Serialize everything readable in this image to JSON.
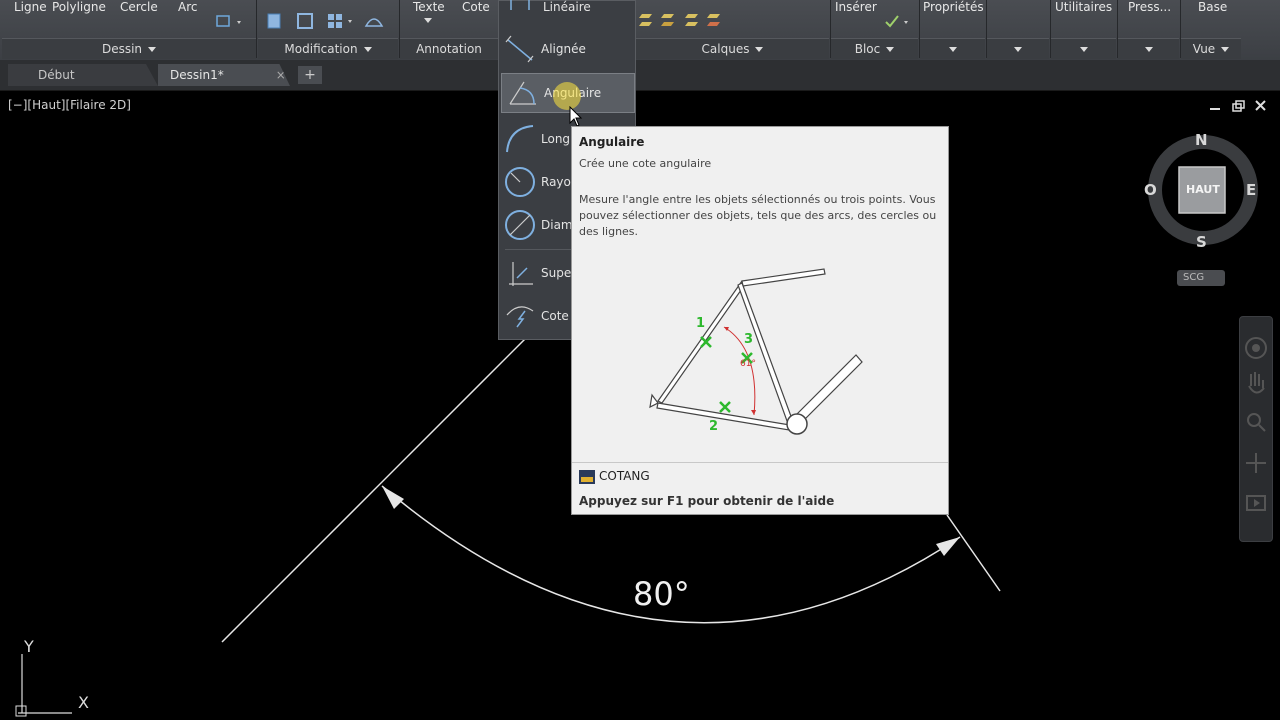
{
  "ribbon": {
    "draw_tools": [
      "Ligne",
      "Polyligne",
      "Cercle",
      "Arc"
    ],
    "annotation_tools": [
      "Texte",
      "Cote"
    ],
    "panels": {
      "dessin": "Dessin",
      "modification": "Modification",
      "annotation": "Annotation",
      "calques": "Calques",
      "bloc": "Bloc",
      "vue": "Vue"
    },
    "right_tools": {
      "inserer": "Insérer",
      "proprietes": "Propriétés",
      "utilitaires": "Utilitaires",
      "presse_papiers": "Press...",
      "base": "Base"
    }
  },
  "tabs": {
    "start": "Début",
    "drawing": "Dessin1*",
    "close": "×",
    "add": "+"
  },
  "viewport": {
    "label": "[−][Haut][Filaire 2D]",
    "dimension_text": "80°",
    "ucs_y": "Y",
    "ucs_x": "X"
  },
  "dropdown": {
    "items": [
      {
        "label": "Linéaire",
        "highlighted": false
      },
      {
        "label": "Alignée",
        "highlighted": false
      },
      {
        "label": "Angulaire",
        "highlighted": true
      },
      {
        "label": "Longu",
        "highlighted": false
      },
      {
        "label": "Rayon",
        "highlighted": false
      },
      {
        "label": "Diam",
        "highlighted": false
      },
      {
        "label": "Super",
        "highlighted": false
      },
      {
        "label": "Cote",
        "highlighted": false
      }
    ]
  },
  "tooltip": {
    "title": "Angulaire",
    "subtitle": "Crée une cote angulaire",
    "description": "Mesure l'angle entre les objets sélectionnés ou trois points. Vous pouvez sélectionner des objets, tels que des arcs, des cercles ou des lignes.",
    "illustration": {
      "point1": "1",
      "point2": "2",
      "point3": "3",
      "angle": "61°"
    },
    "command": "COTANG",
    "help": "Appuyez sur F1 pour obtenir de l'aide"
  },
  "viewcube": {
    "north": "N",
    "south": "S",
    "east": "E",
    "west": "O",
    "face": "HAUT",
    "ucs": "SCG"
  },
  "colors": {
    "ribbon": "#43464b",
    "viewport": "#000000",
    "tooltip_bg": "#f0f0f0",
    "marker_green": "#2db82d",
    "dim_red": "#d03030"
  }
}
